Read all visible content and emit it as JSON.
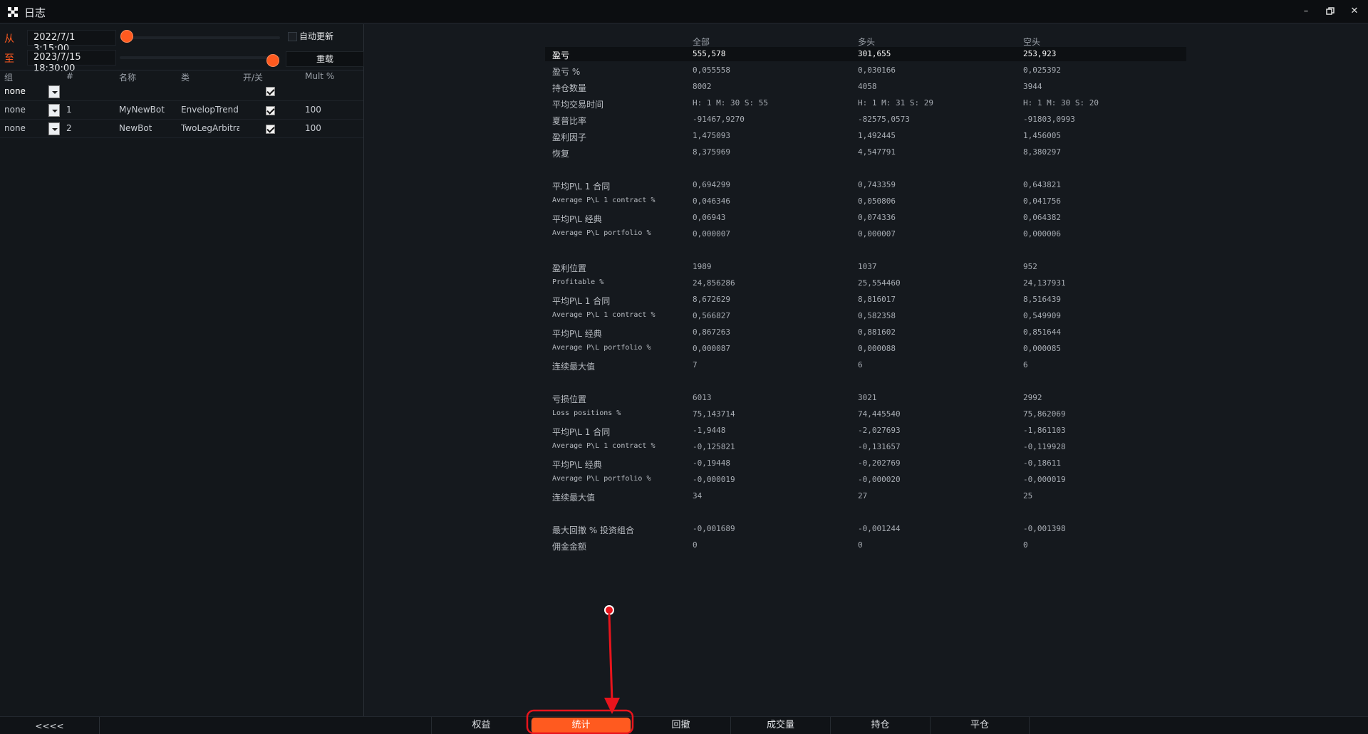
{
  "window": {
    "title": "日志"
  },
  "range": {
    "from_label": "从",
    "from_value": "2022/7/1 3:15:00",
    "to_label": "至",
    "to_value": "2023/7/15 18:30:00",
    "auto_update_label": "自动更新",
    "auto_update_checked": false,
    "reload_label": "重载"
  },
  "bots_table": {
    "headers": {
      "group": "组",
      "num": "#",
      "name": "名称",
      "type": "类",
      "toggle": "开/关",
      "mult": "Mult %"
    },
    "rows": [
      {
        "group": "none",
        "num": "",
        "name": "",
        "type": "",
        "on": true,
        "mult": ""
      },
      {
        "group": "none",
        "num": "1",
        "name": "MyNewBot",
        "type": "EnvelopTrend",
        "on": true,
        "mult": "100"
      },
      {
        "group": "none",
        "num": "2",
        "name": "NewBot",
        "type": "TwoLegArbitra",
        "on": true,
        "mult": "100"
      }
    ]
  },
  "stats": {
    "headers": {
      "all": "全部",
      "long": "多头",
      "short": "空头"
    },
    "rows": [
      {
        "label": "盈亏",
        "all": "555,578",
        "long": "301,655",
        "short": "253,923"
      },
      {
        "label": "盈亏 %",
        "all": "0,055558",
        "long": "0,030166",
        "short": "0,025392"
      },
      {
        "label": "持仓数量",
        "all": "8002",
        "long": "4058",
        "short": "3944"
      },
      {
        "label": "平均交易时间",
        "all": "H: 1 M: 30 S: 55",
        "long": "H: 1 M: 31 S: 29",
        "short": "H: 1 M: 30 S: 20"
      },
      {
        "label": "夏普比率",
        "all": "-91467,9270",
        "long": "-82575,0573",
        "short": "-91803,0993"
      },
      {
        "label": "盈利因子",
        "all": "1,475093",
        "long": "1,492445",
        "short": "1,456005"
      },
      {
        "label": "恢复",
        "all": "8,375969",
        "long": "4,547791",
        "short": "8,380297"
      },
      {
        "label": "平均P\\L 1 合同",
        "all": "0,694299",
        "long": "0,743359",
        "short": "0,643821"
      },
      {
        "label": "Average P\\L 1 contract %",
        "all": "0,046346",
        "long": "0,050806",
        "short": "0,041756"
      },
      {
        "label": "平均P\\L 经典",
        "all": "0,06943",
        "long": "0,074336",
        "short": "0,064382"
      },
      {
        "label": "Average P\\L portfolio %",
        "all": "0,000007",
        "long": "0,000007",
        "short": "0,000006"
      },
      {
        "label": "盈利位置",
        "all": "1989",
        "long": "1037",
        "short": "952"
      },
      {
        "label": "Profitable %",
        "all": "24,856286",
        "long": "25,554460",
        "short": "24,137931"
      },
      {
        "label": "平均P\\L 1 合同",
        "all": "8,672629",
        "long": "8,816017",
        "short": "8,516439"
      },
      {
        "label": "Average P\\L 1 contract %",
        "all": "0,566827",
        "long": "0,582358",
        "short": "0,549909"
      },
      {
        "label": "平均P\\L 经典",
        "all": "0,867263",
        "long": "0,881602",
        "short": "0,851644"
      },
      {
        "label": "Average P\\L portfolio %",
        "all": "0,000087",
        "long": "0,000088",
        "short": "0,000085"
      },
      {
        "label": "连续最大值",
        "all": "7",
        "long": "6",
        "short": "6"
      },
      {
        "label": "亏损位置",
        "all": "6013",
        "long": "3021",
        "short": "2992"
      },
      {
        "label": "Loss positions %",
        "all": "75,143714",
        "long": "74,445540",
        "short": "75,862069"
      },
      {
        "label": "平均P\\L 1 合同",
        "all": "-1,9448",
        "long": "-2,027693",
        "short": "-1,861103"
      },
      {
        "label": "Average P\\L 1 contract %",
        "all": "-0,125821",
        "long": "-0,131657",
        "short": "-0,119928"
      },
      {
        "label": "平均P\\L 经典",
        "all": "-0,19448",
        "long": "-0,202769",
        "short": "-0,18611"
      },
      {
        "label": "Average P\\L portfolio %",
        "all": "-0,000019",
        "long": "-0,000020",
        "short": "-0,000019"
      },
      {
        "label": "连续最大值",
        "all": "34",
        "long": "27",
        "short": "25"
      },
      {
        "label": "最大回撤 % 投资组合",
        "all": "-0,001689",
        "long": "-0,001244",
        "short": "-0,001398"
      },
      {
        "label": "佣金金额",
        "all": "0",
        "long": "0",
        "short": "0"
      }
    ]
  },
  "bottom_bar": {
    "back_label": "<<<<",
    "tabs": [
      "权益",
      "统计",
      "回撤",
      "成交量",
      "持仓",
      "平仓"
    ],
    "active_tab": "统计"
  },
  "colors": {
    "accent": "#ff5a1f",
    "annotation": "#e8141c"
  },
  "icons": {
    "app": "app-logo-icon",
    "minimize": "minimize-icon",
    "restore": "restore-icon",
    "close": "close-icon"
  }
}
